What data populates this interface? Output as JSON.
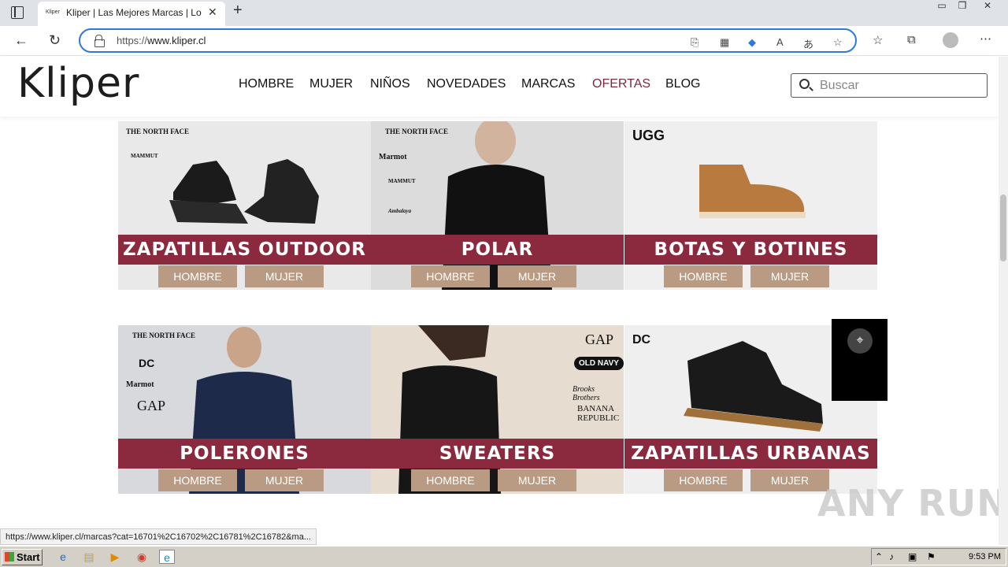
{
  "browser": {
    "tab_title": "Kliper | Las Mejores Marcas | Lo ú",
    "tab_favicon": "Kliper",
    "url_prefix": "https://",
    "url_domain": "www.kliper.cl",
    "status_url": "https://www.kliper.cl/marcas?cat=16701%2C16702%2C16781%2C16782&ma..."
  },
  "site": {
    "logo": "Kliper",
    "nav": [
      "HOMBRE",
      "MUJER",
      "NIÑOS",
      "NOVEDADES",
      "MARCAS",
      "OFERTAS",
      "BLOG"
    ],
    "search_placeholder": "Buscar",
    "accent_color": "#8b2a3e",
    "button_color": "#b99a82"
  },
  "categories": [
    {
      "title": "ZAPATILLAS OUTDOOR",
      "brands": [
        "THE NORTH FACE",
        "MAMMUT"
      ],
      "buttons": [
        "HOMBRE",
        "MUJER"
      ]
    },
    {
      "title": "POLAR",
      "brands": [
        "THE NORTH FACE",
        "Marmot",
        "MAMMUT",
        "Ambalaya"
      ],
      "buttons": [
        "HOMBRE",
        "MUJER"
      ]
    },
    {
      "title": "BOTAS Y BOTINES",
      "brands": [
        "UGG"
      ],
      "buttons": [
        "HOMBRE",
        "MUJER"
      ]
    },
    {
      "title": "POLERONES",
      "brands": [
        "THE NORTH FACE",
        "DC",
        "Marmot",
        "GAP"
      ],
      "buttons": [
        "HOMBRE",
        "MUJER"
      ]
    },
    {
      "title": "SWEATERS",
      "brands": [
        "GAP",
        "OLD NAVY",
        "Brooks Brothers",
        "BANANA REPUBLIC"
      ],
      "buttons": [
        "HOMBRE",
        "MUJER"
      ]
    },
    {
      "title": "ZAPATILLAS URBANAS",
      "brands": [
        "DC"
      ],
      "buttons": [
        "HOMBRE",
        "MUJER"
      ]
    }
  ],
  "watermark": "ANY RUN",
  "taskbar": {
    "start_label": "Start",
    "clock": "9:53 PM"
  }
}
